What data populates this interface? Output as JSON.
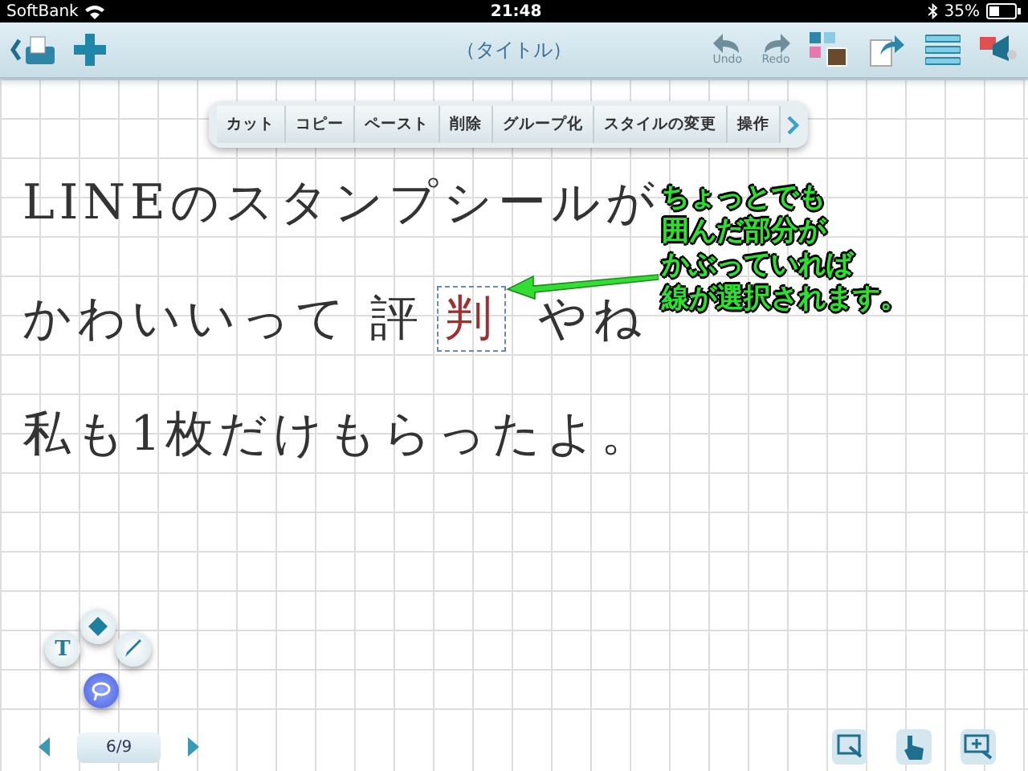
{
  "status_bar": {
    "carrier": "SoftBank",
    "time": "21:48",
    "battery": "35%"
  },
  "toolbar": {
    "title": "（タイトル）",
    "undo": {
      "label": "Undo",
      "disabled": true
    },
    "redo": {
      "label": "Redo",
      "disabled": true
    }
  },
  "context_menu": {
    "items": [
      "カット",
      "コピー",
      "ペースト",
      "削除",
      "グループ化",
      "スタイルの変更",
      "操作"
    ]
  },
  "note": {
    "lines": [
      {
        "segments": [
          {
            "text": "LINEのスタンプシールが",
            "selected": false
          }
        ]
      },
      {
        "segments": [
          {
            "text": "かわいいって 評",
            "selected": false
          },
          {
            "text": "判",
            "selected": true
          },
          {
            "text": " やね",
            "selected": false
          }
        ]
      },
      {
        "segments": [
          {
            "text": "私も1枚だけもらったよ。",
            "selected": false
          }
        ]
      }
    ]
  },
  "callout": {
    "lines": [
      "ちょっとでも",
      "囲んだ部分が",
      "かぶっていれば",
      "線が選択されます。"
    ]
  },
  "tools": [
    {
      "kind": "text",
      "label": "T",
      "selected": false
    },
    {
      "kind": "shape",
      "selected": false
    },
    {
      "kind": "pen",
      "selected": false
    },
    {
      "kind": "lasso",
      "selected": true
    }
  ],
  "page_nav": {
    "page": "6/9"
  }
}
